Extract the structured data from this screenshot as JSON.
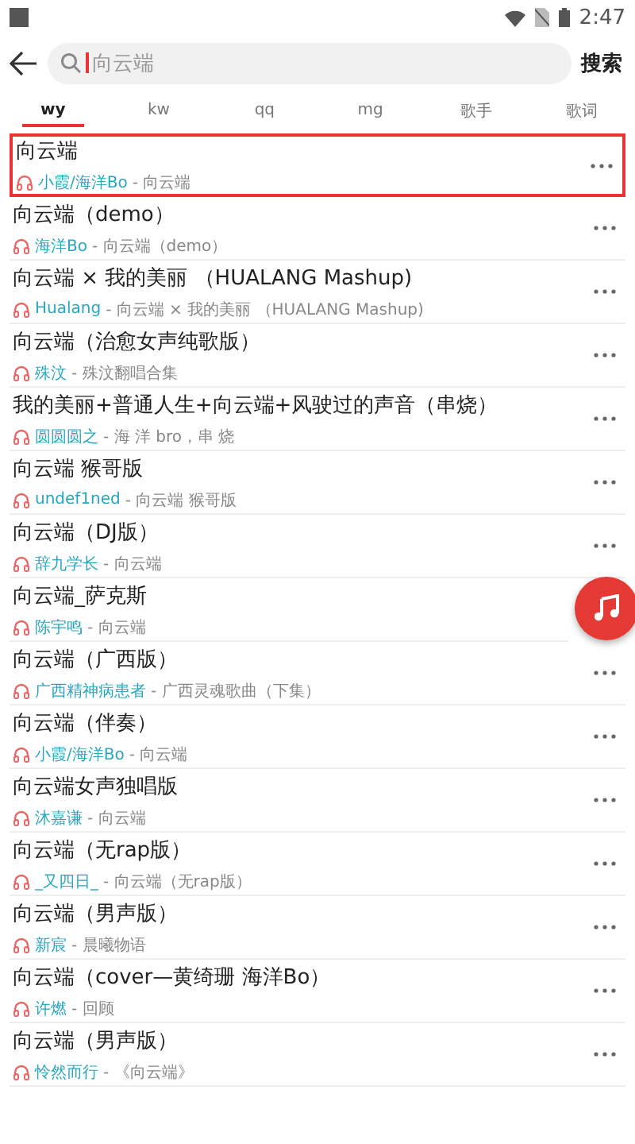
{
  "status_bar": {
    "time": "2:47"
  },
  "search": {
    "value": "向云端",
    "button": "搜索"
  },
  "tabs": [
    {
      "label": "wy",
      "selected": true
    },
    {
      "label": "kw",
      "selected": false
    },
    {
      "label": "qq",
      "selected": false
    },
    {
      "label": "mg",
      "selected": false
    },
    {
      "label": "歌手",
      "selected": false
    },
    {
      "label": "歌词",
      "selected": false
    }
  ],
  "songs": [
    {
      "title": "向云端",
      "artist": "小霞/海洋Bo",
      "album": "- 向云端",
      "selected": true,
      "more": true
    },
    {
      "title": "向云端（demo）",
      "artist": "海洋Bo",
      "album": "- 向云端（demo）",
      "selected": false,
      "more": true
    },
    {
      "title": "向云端 × 我的美丽 （HUALANG Mashup)",
      "artist": "Hualang",
      "album": "- 向云端 × 我的美丽 （HUALANG Mashup)",
      "selected": false,
      "more": true
    },
    {
      "title": "向云端（治愈女声纯歌版）",
      "artist": "殊汶",
      "album": "- 殊汶翻唱合集",
      "selected": false,
      "more": true
    },
    {
      "title": "我的美丽+普通人生+向云端+风驶过的声音（串烧）",
      "artist": "圆圆圆之",
      "album": "- 海 洋 bro，串 烧",
      "selected": false,
      "more": true
    },
    {
      "title": "向云端 猴哥版",
      "artist": "undef1ned",
      "album": "- 向云端 猴哥版",
      "selected": false,
      "more": true
    },
    {
      "title": "向云端（DJ版）",
      "artist": "辞九学长",
      "album": "- 向云端",
      "selected": false,
      "more": true
    },
    {
      "title": "向云端_萨克斯",
      "artist": "陈宇鸣",
      "album": "- 向云端",
      "selected": false,
      "more": false
    },
    {
      "title": "向云端（广西版）",
      "artist": "广西精神病患者",
      "album": "- 广西灵魂歌曲（下集）",
      "selected": false,
      "more": true
    },
    {
      "title": "向云端（伴奏）",
      "artist": "小霞/海洋Bo",
      "album": "- 向云端",
      "selected": false,
      "more": true
    },
    {
      "title": "向云端女声独唱版",
      "artist": "沐嘉谦",
      "album": "- 向云端",
      "selected": false,
      "more": true
    },
    {
      "title": "向云端（无rap版）",
      "artist": "_又四日_",
      "album": "- 向云端（无rap版）",
      "selected": false,
      "more": true
    },
    {
      "title": "向云端（男声版）",
      "artist": "新宸",
      "album": "- 晨曦物语",
      "selected": false,
      "more": true
    },
    {
      "title": "向云端（cover—黄绮珊 海洋Bo）",
      "artist": "许燃",
      "album": "- 回顾",
      "selected": false,
      "more": true
    },
    {
      "title": "向云端（男声版）",
      "artist": "怜然而行",
      "album": "- 《向云端》",
      "selected": false,
      "more": true
    }
  ]
}
